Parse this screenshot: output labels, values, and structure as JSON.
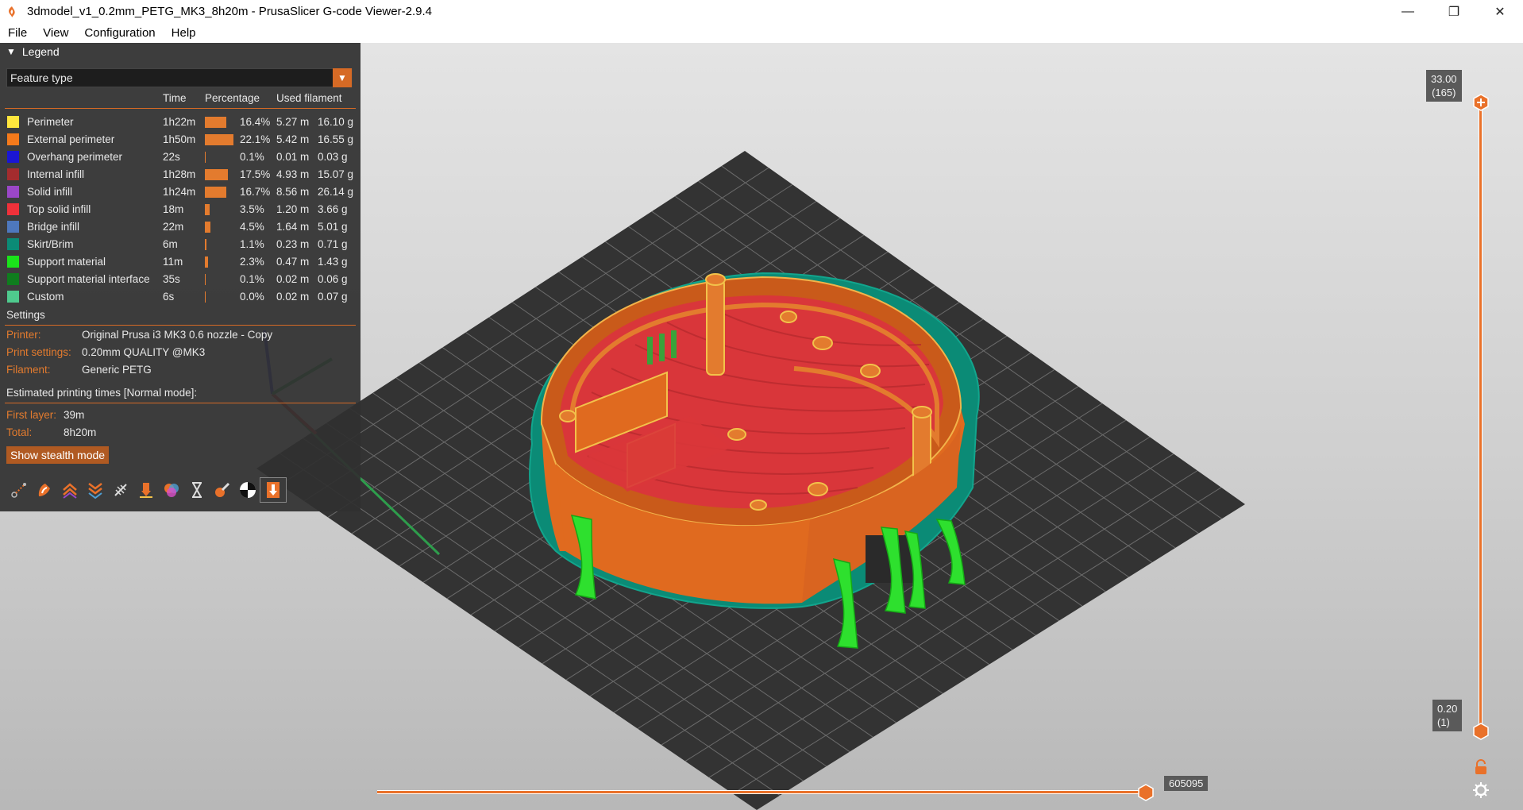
{
  "window": {
    "title": "3dmodel_v1_0.2mm_PETG_MK3_8h20m - PrusaSlicer G-code Viewer-2.9.4",
    "controls": {
      "minimize": "—",
      "maximize": "❐",
      "close": "✕"
    }
  },
  "menu": {
    "items": [
      "File",
      "View",
      "Configuration",
      "Help"
    ]
  },
  "legend": {
    "title": "Legend",
    "view_type": "Feature type",
    "columns": {
      "time": "Time",
      "percentage": "Percentage",
      "used_filament": "Used filament"
    },
    "features": [
      {
        "name": "Perimeter",
        "color": "#ffe63d",
        "time": "1h22m",
        "pct": "16.4%",
        "pct_value": 16.4,
        "length": "5.27 m",
        "weight": "16.10 g"
      },
      {
        "name": "External perimeter",
        "color": "#f57a1b",
        "time": "1h50m",
        "pct": "22.1%",
        "pct_value": 22.1,
        "length": "5.42 m",
        "weight": "16.55 g"
      },
      {
        "name": "Overhang perimeter",
        "color": "#1a16d4",
        "time": "22s",
        "pct": "0.1%",
        "pct_value": 0.1,
        "length": "0.01 m",
        "weight": "0.03 g"
      },
      {
        "name": "Internal infill",
        "color": "#a42c2e",
        "time": "1h28m",
        "pct": "17.5%",
        "pct_value": 17.5,
        "length": "4.93 m",
        "weight": "15.07 g"
      },
      {
        "name": "Solid infill",
        "color": "#9b47c8",
        "time": "1h24m",
        "pct": "16.7%",
        "pct_value": 16.7,
        "length": "8.56 m",
        "weight": "26.14 g"
      },
      {
        "name": "Top solid infill",
        "color": "#f0313a",
        "time": "18m",
        "pct": "3.5%",
        "pct_value": 3.5,
        "length": "1.20 m",
        "weight": "3.66 g"
      },
      {
        "name": "Bridge infill",
        "color": "#4e78bd",
        "time": "22m",
        "pct": "4.5%",
        "pct_value": 4.5,
        "length": "1.64 m",
        "weight": "5.01 g"
      },
      {
        "name": "Skirt/Brim",
        "color": "#0b8b76",
        "time": "6m",
        "pct": "1.1%",
        "pct_value": 1.1,
        "length": "0.23 m",
        "weight": "0.71 g"
      },
      {
        "name": "Support material",
        "color": "#1ae31a",
        "time": "11m",
        "pct": "2.3%",
        "pct_value": 2.3,
        "length": "0.47 m",
        "weight": "1.43 g"
      },
      {
        "name": "Support material interface",
        "color": "#0f7d1e",
        "time": "35s",
        "pct": "0.1%",
        "pct_value": 0.1,
        "length": "0.02 m",
        "weight": "0.06 g"
      },
      {
        "name": "Custom",
        "color": "#4fca8e",
        "time": "6s",
        "pct": "0.0%",
        "pct_value": 0.0,
        "length": "0.02 m",
        "weight": "0.07 g"
      }
    ],
    "settings": {
      "heading": "Settings",
      "printer_label": "Printer:",
      "printer": "Original Prusa i3 MK3 0.6 nozzle - Copy",
      "print_label": "Print settings:",
      "print": "0.20mm QUALITY @MK3",
      "filament_label": "Filament:",
      "filament": "Generic PETG"
    },
    "times": {
      "heading": "Estimated printing times [Normal mode]:",
      "first_layer_label": "First layer:",
      "first_layer": "39m",
      "total_label": "Total:",
      "total": "8h20m",
      "stealth_button": "Show stealth mode"
    },
    "toolbar_icons": [
      "travel-icon",
      "wipe-icon",
      "retractions-icon",
      "deretractions-icon",
      "seams-icon",
      "tool-changes-icon",
      "color-changes-icon",
      "pause-icon",
      "custom-gcode-icon",
      "center-of-gravity-icon",
      "tool-marker-icon"
    ]
  },
  "layer_slider": {
    "top_height": "33.00",
    "top_layer": "(165)",
    "bottom_height": "0.20",
    "bottom_layer": "(1)"
  },
  "move_slider": {
    "value": "605095"
  },
  "colors": {
    "accent": "#e9712a",
    "panel": "#303030"
  }
}
